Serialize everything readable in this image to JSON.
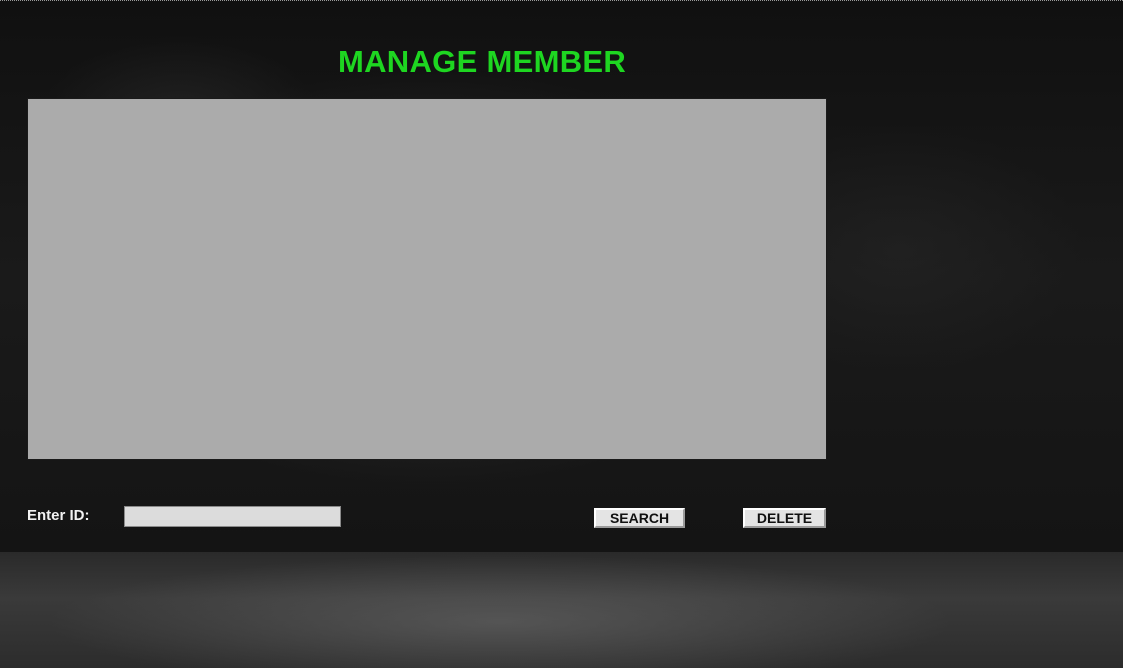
{
  "header": {
    "title": "MANAGE MEMBER"
  },
  "member_table": {
    "columns": [],
    "rows": []
  },
  "form": {
    "id_label": "Enter ID:",
    "id_value": "",
    "id_placeholder": "",
    "search_label": "SEARCH",
    "delete_label": "DELETE"
  },
  "colors": {
    "title": "#1ed621",
    "table_background": "#ababab",
    "label": "#f2f2f2"
  }
}
